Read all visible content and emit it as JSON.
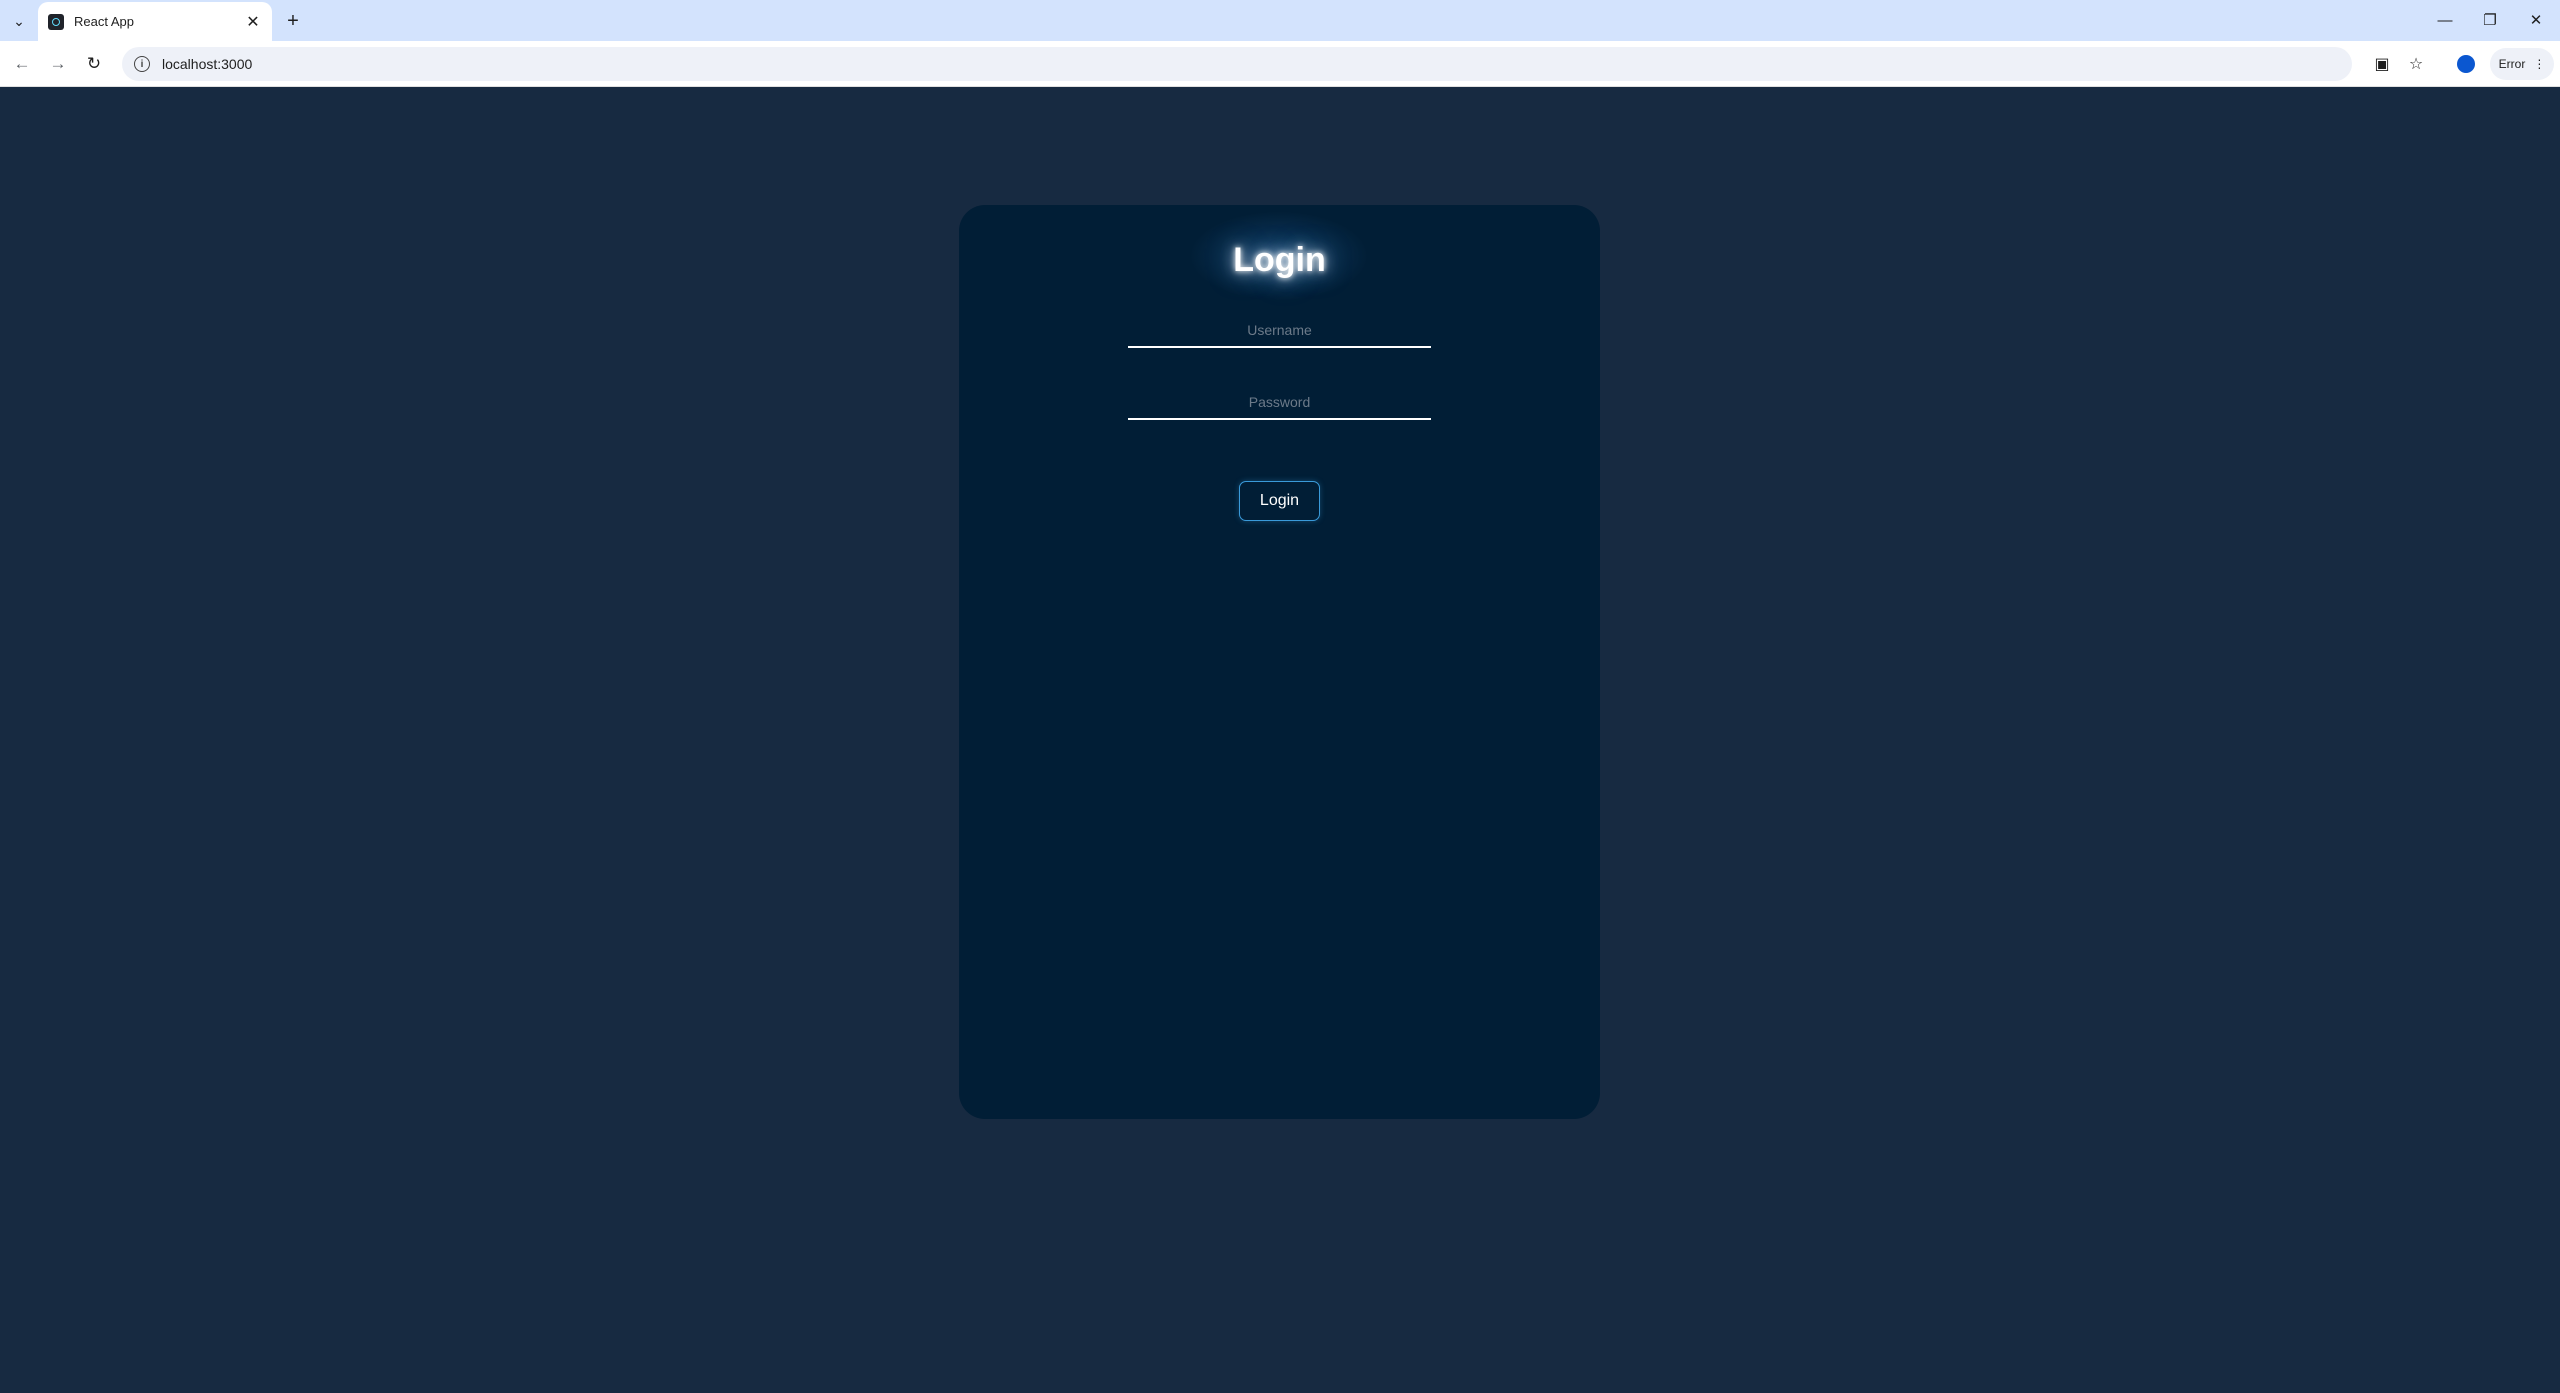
{
  "browser": {
    "tab_title": "React App",
    "tab_close": "✕",
    "new_tab": "+",
    "url": "localhost:3000",
    "error_label": "Error"
  },
  "page": {
    "title": "Login",
    "username_placeholder": "Username",
    "password_placeholder": "Password",
    "login_button": "Login"
  },
  "colors": {
    "page_background": "#172a41",
    "card_background": "#011e36",
    "button_border": "#3a9ad9"
  }
}
